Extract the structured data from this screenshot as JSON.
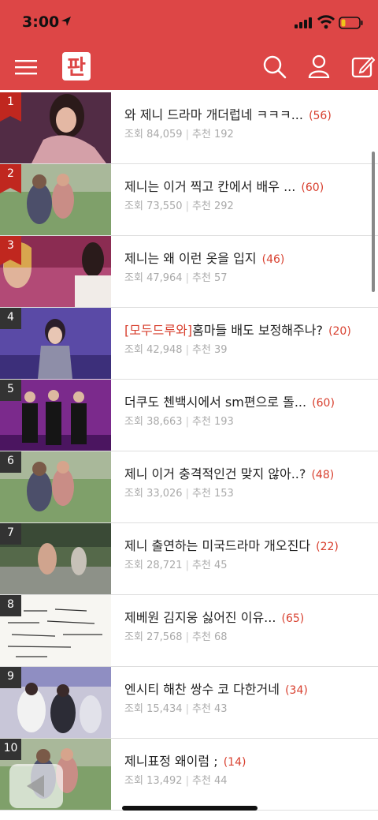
{
  "status": {
    "time": "3:00"
  },
  "app": {
    "logo_text": "판"
  },
  "posts": [
    {
      "rank": "1",
      "tag": "",
      "title": "와 제니 드라마 개더럽네 ㅋㅋㅋ...",
      "comments": "(56)",
      "views_label": "조회",
      "views": "84,059",
      "rec_label": "추천",
      "rec": "192"
    },
    {
      "rank": "2",
      "tag": "",
      "title": "제니는 이거 찍고 칸에서 배우 ...",
      "comments": "(60)",
      "views_label": "조회",
      "views": "73,550",
      "rec_label": "추천",
      "rec": "292"
    },
    {
      "rank": "3",
      "tag": "",
      "title": "제니는 왜 이런 옷을 입지",
      "comments": "(46)",
      "views_label": "조회",
      "views": "47,964",
      "rec_label": "추천",
      "rec": "57"
    },
    {
      "rank": "4",
      "tag": "[모두드루와]",
      "title": "홈마들 배도 보정해주나?",
      "comments": "(20)",
      "views_label": "조회",
      "views": "42,948",
      "rec_label": "추천",
      "rec": "39"
    },
    {
      "rank": "5",
      "tag": "",
      "title": "더쿠도 첸백시에서 sm편으로 돌...",
      "comments": "(60)",
      "views_label": "조회",
      "views": "38,663",
      "rec_label": "추천",
      "rec": "193"
    },
    {
      "rank": "6",
      "tag": "",
      "title": "제니 이거 충격적인건 맞지 않아..?",
      "comments": "(48)",
      "views_label": "조회",
      "views": "33,026",
      "rec_label": "추천",
      "rec": "153"
    },
    {
      "rank": "7",
      "tag": "",
      "title": "제니 출연하는 미국드라마 개오진다",
      "comments": "(22)",
      "views_label": "조회",
      "views": "28,721",
      "rec_label": "추천",
      "rec": "45"
    },
    {
      "rank": "8",
      "tag": "",
      "title": "제베원 김지웅 싫어진 이유...",
      "comments": "(65)",
      "views_label": "조회",
      "views": "27,568",
      "rec_label": "추천",
      "rec": "68"
    },
    {
      "rank": "9",
      "tag": "",
      "title": "엔시티 해찬 쌍수 코 다한거네",
      "comments": "(34)",
      "views_label": "조회",
      "views": "15,434",
      "rec_label": "추천",
      "rec": "43"
    },
    {
      "rank": "10",
      "tag": "",
      "title": "제니표정 왜이럼 ;",
      "comments": "(14)",
      "views_label": "조회",
      "views": "13,492",
      "rec_label": "추천",
      "rec": "44"
    }
  ],
  "colors": {
    "brand": "#dd4646",
    "rank_top": "#c0271f",
    "rank_other": "#333333",
    "accent_text": "#d8402f"
  },
  "icons": [
    "location-arrow-icon",
    "signal-icon",
    "wifi-icon",
    "battery-icon",
    "hamburger-menu-icon",
    "pann-logo",
    "search-icon",
    "user-icon",
    "write-icon",
    "back-arrow-icon"
  ]
}
